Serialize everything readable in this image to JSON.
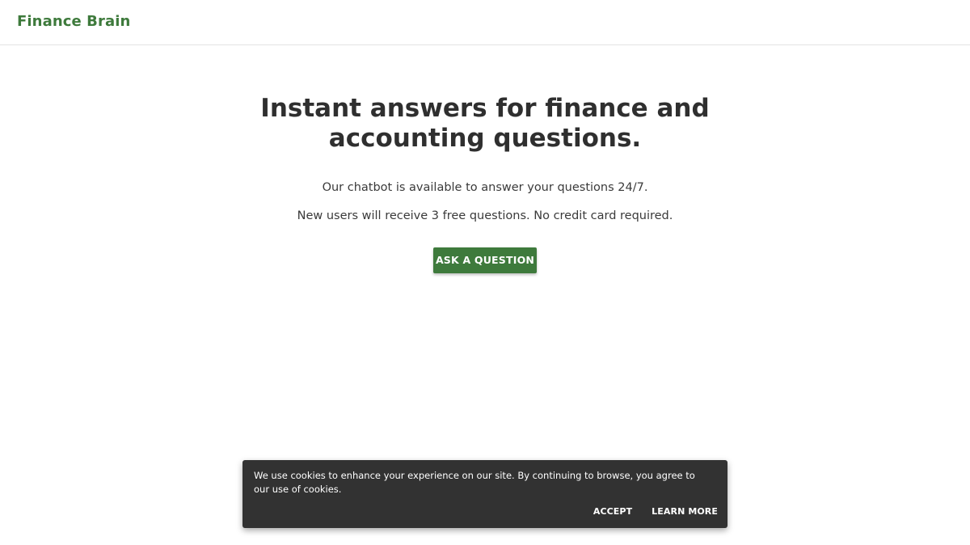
{
  "header": {
    "brand": "Finance Brain"
  },
  "hero": {
    "title": "Instant answers for finance and accounting questions.",
    "line1": "Our chatbot is available to answer your questions 24/7.",
    "line2": "New users will receive 3 free questions. No credit card required.",
    "cta_label": "ASK A QUESTION"
  },
  "cookie": {
    "message": "We use cookies to enhance your experience on our site. By continuing to browse, you agree to our use of cookies.",
    "accept_label": "ACCEPT",
    "learn_more_label": "LEARN MORE"
  },
  "colors": {
    "brand_green": "#3e7a3c",
    "banner_bg": "#323232",
    "text_dark": "#2f2f2f"
  }
}
